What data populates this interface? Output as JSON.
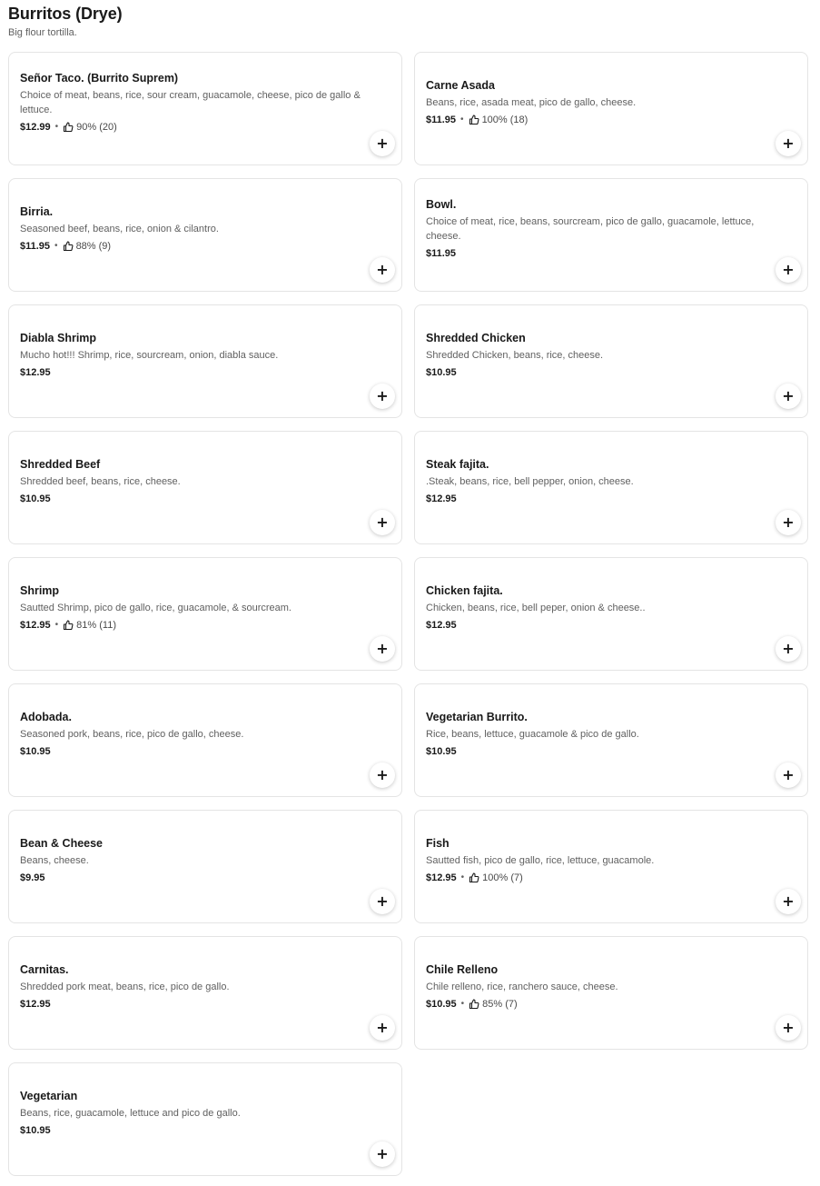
{
  "section": {
    "title": "Burritos (Drye)",
    "subtitle": "Big flour tortilla."
  },
  "add_label": "+",
  "items": [
    {
      "name": "Señor Taco. (Burrito Suprem)",
      "description": "Choice of meat, beans, rice, sour cream, guacamole, cheese, pico de gallo & lettuce.",
      "price": "$12.99",
      "rating": "90% (20)"
    },
    {
      "name": "Carne Asada",
      "description": "Beans, rice, asada meat, pico de gallo, cheese.",
      "price": "$11.95",
      "rating": "100% (18)"
    },
    {
      "name": "Birria.",
      "description": "Seasoned beef, beans, rice, onion & cilantro.",
      "price": "$11.95",
      "rating": "88% (9)"
    },
    {
      "name": "Bowl.",
      "description": "Choice of meat, rice, beans, sourcream, pico de gallo, guacamole, lettuce, cheese.",
      "price": "$11.95",
      "rating": null
    },
    {
      "name": "Diabla Shrimp",
      "description": "Mucho hot!!! Shrimp, rice, sourcream, onion, diabla sauce.",
      "price": "$12.95",
      "rating": null
    },
    {
      "name": "Shredded Chicken",
      "description": "Shredded Chicken, beans, rice, cheese.",
      "price": "$10.95",
      "rating": null
    },
    {
      "name": "Shredded Beef",
      "description": "Shredded beef, beans, rice, cheese.",
      "price": "$10.95",
      "rating": null
    },
    {
      "name": "Steak fajita.",
      "description": ".Steak, beans, rice, bell pepper, onion, cheese.",
      "price": "$12.95",
      "rating": null
    },
    {
      "name": "Shrimp",
      "description": "Sautted Shrimp, pico de gallo, rice, guacamole, & sourcream.",
      "price": "$12.95",
      "rating": "81% (11)"
    },
    {
      "name": "Chicken fajita.",
      "description": "Chicken, beans, rice, bell peper, onion & cheese..",
      "price": "$12.95",
      "rating": null
    },
    {
      "name": "Adobada.",
      "description": "Seasoned pork, beans, rice, pico de gallo, cheese.",
      "price": "$10.95",
      "rating": null
    },
    {
      "name": "Vegetarian Burrito.",
      "description": "Rice, beans, lettuce, guacamole & pico de gallo.",
      "price": "$10.95",
      "rating": null
    },
    {
      "name": "Bean & Cheese",
      "description": "Beans, cheese.",
      "price": "$9.95",
      "rating": null
    },
    {
      "name": "Fish",
      "description": "Sautted fish, pico de gallo, rice, lettuce, guacamole.",
      "price": "$12.95",
      "rating": "100% (7)"
    },
    {
      "name": "Carnitas.",
      "description": "Shredded pork meat, beans, rice, pico de gallo.",
      "price": "$12.95",
      "rating": null
    },
    {
      "name": "Chile Relleno",
      "description": "Chile relleno, rice, ranchero sauce, cheese.",
      "price": "$10.95",
      "rating": "85% (7)"
    },
    {
      "name": "Vegetarian",
      "description": "Beans, rice, guacamole, lettuce and pico de gallo.",
      "price": "$10.95",
      "rating": null
    }
  ]
}
